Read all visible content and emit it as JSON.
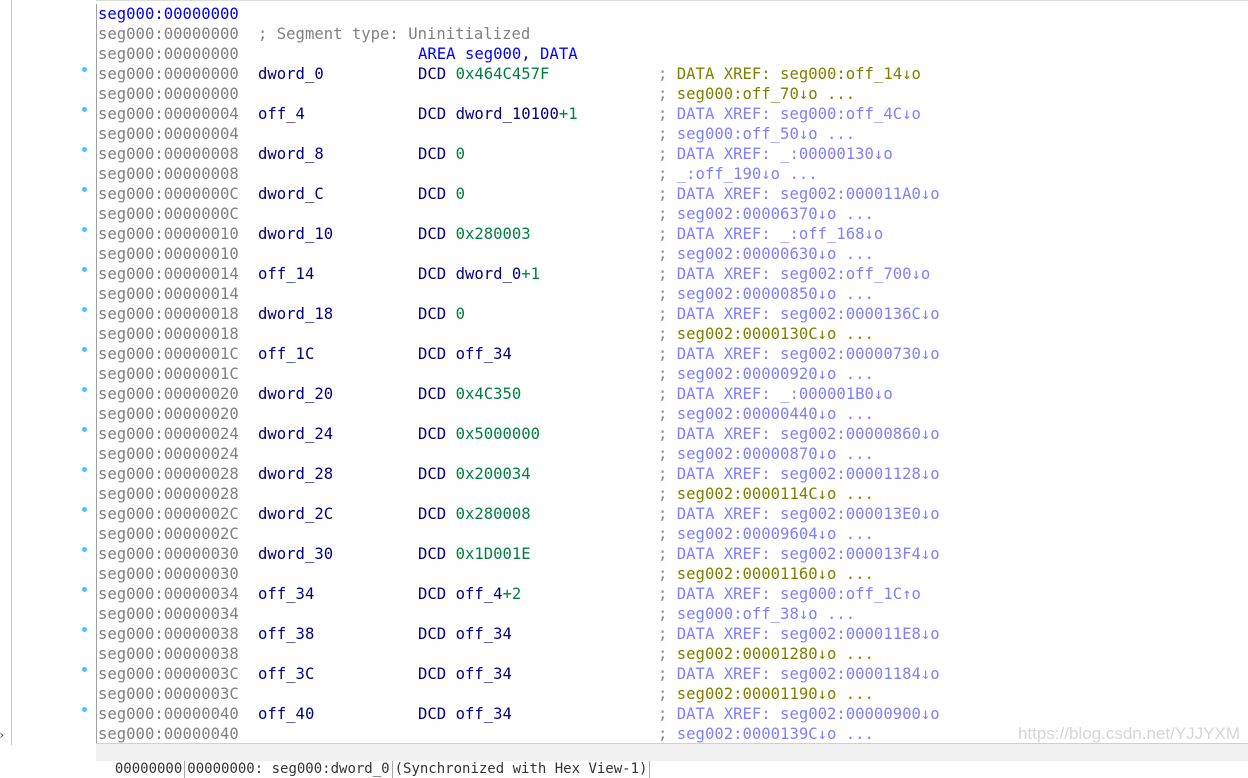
{
  "colors": {
    "address": "#808080",
    "label": "#000080",
    "number": "#008040",
    "xref_olive": "#808000",
    "xref_violet": "#8080ff",
    "header": "#0000ff"
  },
  "header_lines": [
    {
      "addr": "seg000:00000000",
      "text": ""
    },
    {
      "addr": "seg000:00000000",
      "text": "; Segment type: Uninitialized"
    },
    {
      "addr": "seg000:00000000",
      "text": "AREA seg000, DATA"
    }
  ],
  "rows": [
    {
      "addr": "seg000:00000000",
      "label": "dword_0",
      "ins": "DCD",
      "op_name": "",
      "op_num": "0x464C457F",
      "op_suffix": "",
      "c1": "DATA XREF: seg000:off_14↓o",
      "c1c": "olive",
      "c2": "seg000:off_70↓o ...",
      "c2c": "olive"
    },
    {
      "addr": "seg000:00000004",
      "label": "off_4",
      "ins": "DCD",
      "op_name": "dword_10100",
      "op_num": "",
      "op_suffix": "+1",
      "c1": "DATA XREF: seg000:off_4C↓o",
      "c1c": "violet",
      "c2": "seg000:off_50↓o ...",
      "c2c": "violet"
    },
    {
      "addr": "seg000:00000008",
      "label": "dword_8",
      "ins": "DCD",
      "op_name": "",
      "op_num": "0",
      "op_suffix": "",
      "c1": "DATA XREF: _:00000130↓o",
      "c1c": "violet",
      "c2": "_:off_190↓o ...",
      "c2c": "violet"
    },
    {
      "addr": "seg000:0000000C",
      "label": "dword_C",
      "ins": "DCD",
      "op_name": "",
      "op_num": "0",
      "op_suffix": "",
      "c1": "DATA XREF: seg002:000011A0↓o",
      "c1c": "violet",
      "c2": "seg002:00006370↓o ...",
      "c2c": "violet"
    },
    {
      "addr": "seg000:00000010",
      "label": "dword_10",
      "ins": "DCD",
      "op_name": "",
      "op_num": "0x280003",
      "op_suffix": "",
      "c1": "DATA XREF: _:off_168↓o",
      "c1c": "violet",
      "c2": "seg002:00000630↓o ...",
      "c2c": "violet"
    },
    {
      "addr": "seg000:00000014",
      "label": "off_14",
      "ins": "DCD",
      "op_name": "dword_0",
      "op_num": "",
      "op_suffix": "+1",
      "c1": "DATA XREF: seg002:off_700↓o",
      "c1c": "violet",
      "c2": "seg002:00000850↓o ...",
      "c2c": "violet"
    },
    {
      "addr": "seg000:00000018",
      "label": "dword_18",
      "ins": "DCD",
      "op_name": "",
      "op_num": "0",
      "op_suffix": "",
      "c1": "DATA XREF: seg002:0000136C↓o",
      "c1c": "violet",
      "c2": "seg002:0000130C↓o ...",
      "c2c": "olive"
    },
    {
      "addr": "seg000:0000001C",
      "label": "off_1C",
      "ins": "DCD",
      "op_name": "off_34",
      "op_num": "",
      "op_suffix": "",
      "c1": "DATA XREF: seg002:00000730↓o",
      "c1c": "violet",
      "c2": "seg002:00000920↓o ...",
      "c2c": "violet"
    },
    {
      "addr": "seg000:00000020",
      "label": "dword_20",
      "ins": "DCD",
      "op_name": "",
      "op_num": "0x4C350",
      "op_suffix": "",
      "c1": "DATA XREF: _:000001B0↓o",
      "c1c": "violet",
      "c2": "seg002:00000440↓o ...",
      "c2c": "violet"
    },
    {
      "addr": "seg000:00000024",
      "label": "dword_24",
      "ins": "DCD",
      "op_name": "",
      "op_num": "0x5000000",
      "op_suffix": "",
      "c1": "DATA XREF: seg002:00000860↓o",
      "c1c": "violet",
      "c2": "seg002:00000870↓o ...",
      "c2c": "violet"
    },
    {
      "addr": "seg000:00000028",
      "label": "dword_28",
      "ins": "DCD",
      "op_name": "",
      "op_num": "0x200034",
      "op_suffix": "",
      "c1": "DATA XREF: seg002:00001128↓o",
      "c1c": "violet",
      "c2": "seg002:0000114C↓o ...",
      "c2c": "olive"
    },
    {
      "addr": "seg000:0000002C",
      "label": "dword_2C",
      "ins": "DCD",
      "op_name": "",
      "op_num": "0x280008",
      "op_suffix": "",
      "c1": "DATA XREF: seg002:000013E0↓o",
      "c1c": "violet",
      "c2": "seg002:00009604↓o ...",
      "c2c": "violet"
    },
    {
      "addr": "seg000:00000030",
      "label": "dword_30",
      "ins": "DCD",
      "op_name": "",
      "op_num": "0x1D001E",
      "op_suffix": "",
      "c1": "DATA XREF: seg002:000013F4↓o",
      "c1c": "violet",
      "c2": "seg002:00001160↓o ...",
      "c2c": "olive"
    },
    {
      "addr": "seg000:00000034",
      "label": "off_34",
      "ins": "DCD",
      "op_name": "off_4",
      "op_num": "",
      "op_suffix": "+2",
      "c1": "DATA XREF: seg000:off_1C↑o",
      "c1c": "violet",
      "c2": "seg000:off_38↓o ...",
      "c2c": "violet"
    },
    {
      "addr": "seg000:00000038",
      "label": "off_38",
      "ins": "DCD",
      "op_name": "off_34",
      "op_num": "",
      "op_suffix": "",
      "c1": "DATA XREF: seg002:000011E8↓o",
      "c1c": "violet",
      "c2": "seg002:00001280↓o ...",
      "c2c": "olive"
    },
    {
      "addr": "seg000:0000003C",
      "label": "off_3C",
      "ins": "DCD",
      "op_name": "off_34",
      "op_num": "",
      "op_suffix": "",
      "c1": "DATA XREF: seg002:00001184↓o",
      "c1c": "violet",
      "c2": "seg002:00001190↓o ...",
      "c2c": "olive"
    },
    {
      "addr": "seg000:00000040",
      "label": "off_40",
      "ins": "DCD",
      "op_name": "off_34",
      "op_num": "",
      "op_suffix": "",
      "c1": "DATA XREF: seg002:00000900↓o",
      "c1c": "violet",
      "c2": "seg002:0000139C↓o ...",
      "c2c": "violet"
    }
  ],
  "status": {
    "offset": "00000000",
    "location": "00000000: seg000:dword_0",
    "sync": "(Synchronized with Hex View-1)"
  },
  "watermark": "https://blog.csdn.net/YJJYXM"
}
